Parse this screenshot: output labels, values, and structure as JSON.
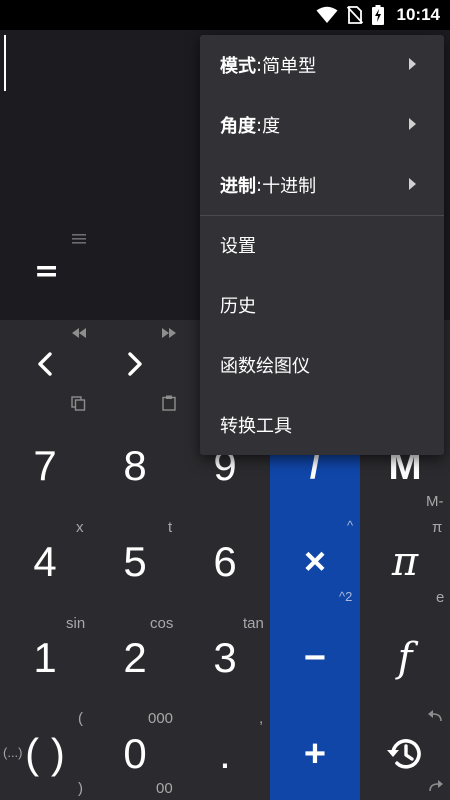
{
  "status_bar": {
    "time": "10:14",
    "icons": [
      "wifi-icon",
      "no-sim-icon",
      "battery-charging-icon"
    ]
  },
  "display": {
    "equals_sign": "="
  },
  "nav_row": {
    "back_label": "<",
    "forward_label": ">"
  },
  "keypad": {
    "rows": [
      {
        "keys": [
          "7",
          "8",
          "9"
        ],
        "op": "/",
        "right": "M",
        "subs": []
      },
      {
        "keys": [
          "4",
          "5",
          "6"
        ],
        "op": "×",
        "right": "π",
        "subs": [
          "x",
          "t",
          "^",
          "M-",
          "π"
        ]
      },
      {
        "keys": [
          "1",
          "2",
          "3"
        ],
        "op": "−",
        "right": "f",
        "subs": [
          "sin",
          "cos",
          "tan",
          "^2",
          "e"
        ]
      },
      {
        "keys": [
          "( )",
          "0",
          "."
        ],
        "op": "+",
        "right": "history",
        "subs": [
          "(",
          "000",
          ",",
          "(...)",
          ")",
          "00"
        ]
      }
    ]
  },
  "menu": {
    "mode_label": "模式",
    "mode_value": "简单型",
    "angle_label": "角度",
    "angle_value": "度",
    "base_label": "进制",
    "base_value": "十进制",
    "settings": "设置",
    "history": "历史",
    "grapher": "函数绘图仪",
    "converter": "转换工具",
    "separator": ": "
  }
}
